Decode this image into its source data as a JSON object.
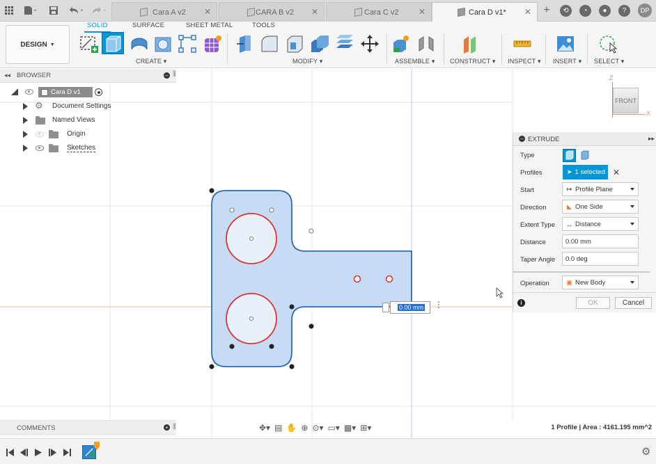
{
  "tabs": [
    {
      "label": "Cara A v2",
      "active": false
    },
    {
      "label": "CARA B v2",
      "active": false
    },
    {
      "label": "Cara C v2",
      "active": false
    },
    {
      "label": "Cara D v1*",
      "active": true
    }
  ],
  "user": {
    "initials": "DP"
  },
  "toolbar": {
    "workspace": "DESIGN",
    "tabs": [
      "SOLID",
      "SURFACE",
      "SHEET METAL",
      "TOOLS"
    ],
    "groups": {
      "create": "CREATE",
      "modify": "MODIFY",
      "assemble": "ASSEMBLE",
      "construct": "CONSTRUCT",
      "inspect": "INSPECT",
      "insert": "INSERT",
      "select": "SELECT"
    }
  },
  "browser": {
    "title": "BROWSER",
    "root": "Cara D v1",
    "items": [
      "Document Settings",
      "Named Views",
      "Origin",
      "Sketches"
    ]
  },
  "viewcube": {
    "face": "FRONT",
    "z_label": "Z",
    "x_label": "X"
  },
  "extrude": {
    "title": "EXTRUDE",
    "labels": {
      "type": "Type",
      "profiles": "Profiles",
      "start": "Start",
      "direction": "Direction",
      "extent_type": "Extent Type",
      "distance": "Distance",
      "taper": "Taper Angle",
      "operation": "Operation"
    },
    "profiles_value": "1 selected",
    "start_value": "Profile Plane",
    "direction_value": "One Side",
    "extent_value": "Distance",
    "distance_value": "0.00 mm",
    "taper_value": "0.0 deg",
    "operation_value": "New Body",
    "ok": "OK",
    "cancel": "Cancel"
  },
  "canvas": {
    "distance_input": "0.00 mm"
  },
  "comments": {
    "title": "COMMENTS"
  },
  "status": {
    "text": "1 Profile | Area : 4161.195 mm^2"
  },
  "colors": {
    "accent": "#0696d7",
    "profile_fill": "#c7dcf4",
    "profile_edge": "#2a6cb0",
    "circle_edge": "#e0302f"
  }
}
